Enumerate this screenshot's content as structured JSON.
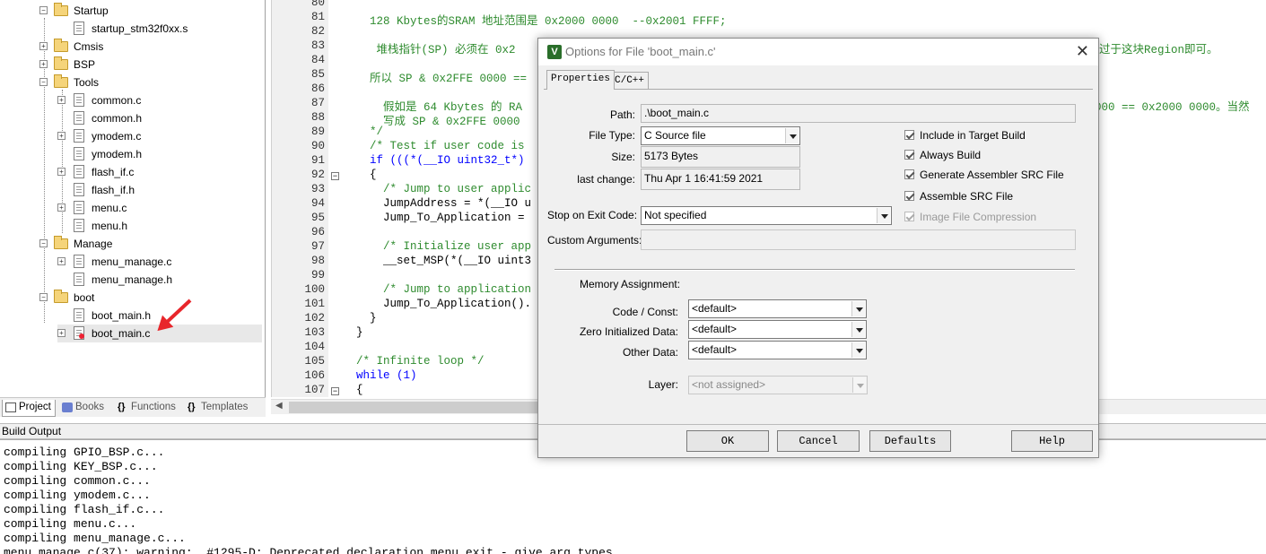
{
  "project_tree": {
    "items": [
      {
        "label": "Startup",
        "kind": "folder"
      },
      {
        "label": "startup_stm32f0xx.s",
        "kind": "file"
      },
      {
        "label": "Cmsis",
        "kind": "folder"
      },
      {
        "label": "BSP",
        "kind": "folder"
      },
      {
        "label": "Tools",
        "kind": "folder"
      },
      {
        "label": "common.c",
        "kind": "file"
      },
      {
        "label": "common.h",
        "kind": "file"
      },
      {
        "label": "ymodem.c",
        "kind": "file"
      },
      {
        "label": "ymodem.h",
        "kind": "file"
      },
      {
        "label": "flash_if.c",
        "kind": "file"
      },
      {
        "label": "flash_if.h",
        "kind": "file"
      },
      {
        "label": "menu.c",
        "kind": "file"
      },
      {
        "label": "menu.h",
        "kind": "file"
      },
      {
        "label": "Manage",
        "kind": "folder"
      },
      {
        "label": "menu_manage.c",
        "kind": "file"
      },
      {
        "label": "menu_manage.h",
        "kind": "file"
      },
      {
        "label": "boot",
        "kind": "folder"
      },
      {
        "label": "boot_main.h",
        "kind": "file"
      },
      {
        "label": "boot_main.c",
        "kind": "file"
      }
    ]
  },
  "panel_tabs": [
    "Project",
    "Books",
    "Functions",
    "Templates"
  ],
  "editor": {
    "line_numbers": [
      "80",
      "81",
      "82",
      "83",
      "84",
      "85",
      "86",
      "87",
      "88",
      "89",
      "90",
      "91",
      "92",
      "93",
      "94",
      "95",
      "96",
      "97",
      "98",
      "99",
      "100",
      "101",
      "102",
      "103",
      "104",
      "105",
      "106",
      "107"
    ],
    "lines": [
      "",
      "  128 Kbytes的SRAM 地址范围是 0x2000 0000  --0x2001 FFFF;",
      "",
      "   堆栈指针(SP) 必须在 0x2",
      "",
      "  所以 SP & 0x2FFE 0000 ==",
      "",
      "    假如是 64 Kbytes 的 RA",
      "    写成 SP & 0x2FFE 0000",
      "  */",
      "  /* Test if user code is",
      "  if (((*(__IO uint32_t*)",
      "  {",
      "    /* Jump to user applic",
      "    JumpAddress = *(__IO u",
      "    Jump_To_Application =",
      "",
      "    /* Initialize user app",
      "    __set_MSP(*(__IO uint3",
      "",
      "    /* Jump to application",
      "    Jump_To_Application().",
      "  }",
      "}",
      "",
      "/* Infinite loop */",
      "while (1)",
      "{"
    ],
    "right_fragment_83": "过于这块Region即可。",
    "right_fragment_87": "000 == 0x2000 0000。当然"
  },
  "build_output": {
    "title": "Build Output",
    "lines": [
      "compiling GPIO_BSP.c...",
      "compiling KEY_BSP.c...",
      "compiling common.c...",
      "compiling ymodem.c...",
      "compiling flash_if.c...",
      "compiling menu.c...",
      "compiling menu_manage.c...",
      "menu_manage.c(37): warning:  #1295-D: Deprecated declaration menu_exit - give arg types"
    ]
  },
  "dialog": {
    "title": "Options for File 'boot_main.c'",
    "close": "✕",
    "app_icon": "V",
    "tabs": [
      "Properties",
      "C/C++"
    ],
    "path_label": "Path:",
    "path_value": ".\\boot_main.c",
    "filetype_label": "File Type:",
    "filetype_value": "C Source file",
    "size_label": "Size:",
    "size_value": "5173 Bytes",
    "lastchange_label": "last change:",
    "lastchange_value": "Thu Apr  1 16:41:59 2021",
    "stop_label": "Stop on Exit Code:",
    "stop_value": "Not specified",
    "custom_label": "Custom Arguments:",
    "custom_value": "",
    "checkboxes": [
      {
        "label": "Include in Target Build",
        "checked": true,
        "enabled": true
      },
      {
        "label": "Always Build",
        "checked": true,
        "enabled": true
      },
      {
        "label": "Generate Assembler SRC File",
        "checked": true,
        "enabled": true
      },
      {
        "label": "Assemble SRC File",
        "checked": true,
        "enabled": true
      },
      {
        "label": "Image File Compression",
        "checked": true,
        "enabled": false
      }
    ],
    "memory_title": "Memory Assignment:",
    "code_const_label": "Code / Const:",
    "code_const_value": "<default>",
    "zero_init_label": "Zero Initialized Data:",
    "zero_init_value": "<default>",
    "other_data_label": "Other Data:",
    "other_data_value": "<default>",
    "layer_label": "Layer:",
    "layer_value": "<not assigned>",
    "buttons": {
      "ok": "OK",
      "cancel": "Cancel",
      "defaults": "Defaults",
      "help": "Help"
    }
  },
  "colors": {
    "comment": "#2e8b2e",
    "keyword": "#0000ff",
    "annotation_arrow": "#e8262b"
  }
}
